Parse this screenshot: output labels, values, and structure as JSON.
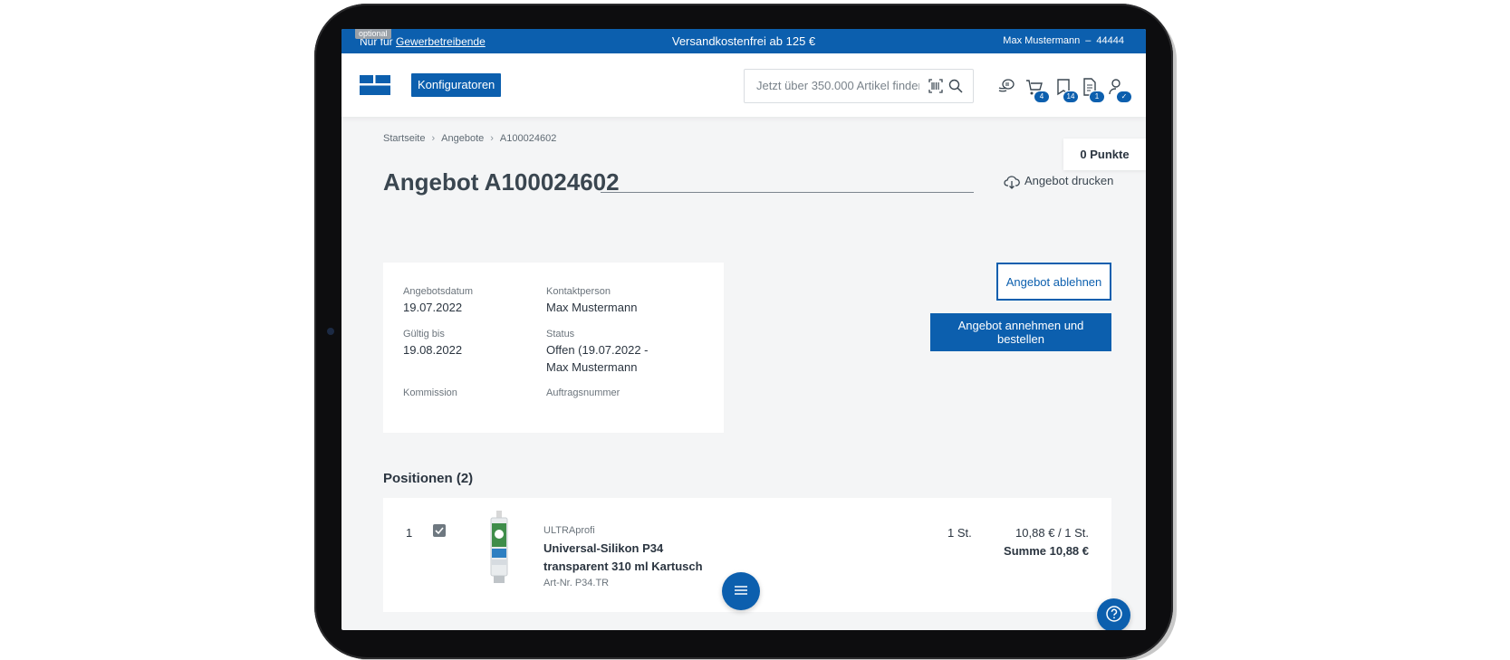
{
  "topbar": {
    "optional_tag": "optional",
    "left_prefix": "Nur für",
    "left_link": "Gewerbetreibende",
    "center": "Versandkostenfrei ab 125 €",
    "user_name": "Max Mustermann",
    "separator": "–",
    "customer_number": "44444"
  },
  "header": {
    "konfig_label": "Konfiguratoren",
    "search_placeholder": "Jetzt über 350.000 Artikel finden",
    "icons": [
      {
        "name": "coins-icon",
        "badge": ""
      },
      {
        "name": "cart-icon",
        "badge": "4"
      },
      {
        "name": "bookmark-icon",
        "badge": "14"
      },
      {
        "name": "document-icon",
        "badge": "1"
      },
      {
        "name": "account-icon",
        "badge": "✓"
      }
    ]
  },
  "breadcrumb": [
    "Startseite",
    "Angebote",
    "A100024602"
  ],
  "points": "0 Punkte",
  "page": {
    "title": "Angebot A100024602",
    "print_label": "Angebot drucken"
  },
  "info": {
    "date_label": "Angebotsdatum",
    "date_value": "19.07.2022",
    "contact_label": "Kontaktperson",
    "contact_value": "Max Mustermann",
    "valid_label": "Gültig bis",
    "valid_value": "19.08.2022",
    "status_label": "Status",
    "status_value": "Offen (19.07.2022 - Max Mustermann",
    "commission_label": "Kommission",
    "order_label": "Auftragsnummer"
  },
  "actions": {
    "decline": "Angebot ablehnen",
    "accept": "Angebot annehmen und bestellen"
  },
  "positions": {
    "title": "Positionen (2)",
    "items": [
      {
        "num": "1",
        "brand": "ULTRAprofi",
        "name": "Universal-Silikon P34 transparent 310 ml Kartusch",
        "article": "Art-Nr. P34.TR",
        "qty": "1 St.",
        "price": "10,88 € / 1 St.",
        "sum": "Summe 10,88 €"
      }
    ]
  },
  "colors": {
    "brand_blue": "#0c5fae",
    "background": "#f4f5f6"
  }
}
